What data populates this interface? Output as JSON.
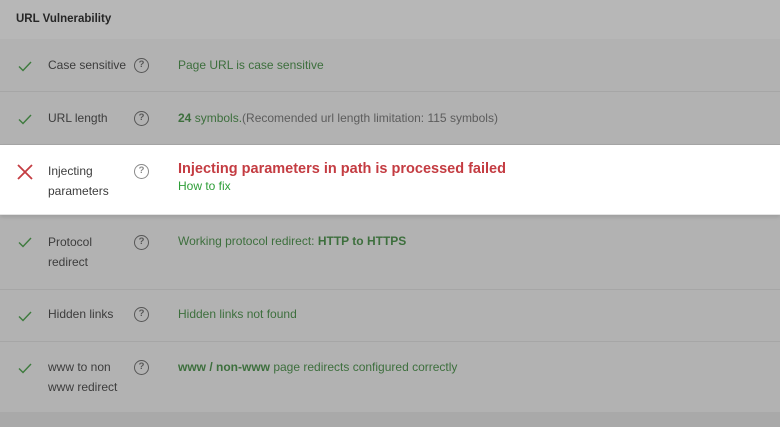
{
  "section_title": "URL Vulnerability",
  "help_glyph": "?",
  "colors": {
    "pass": "#3d6f3d",
    "fail": "#c43c42",
    "link": "#2e9e38"
  },
  "rows": [
    {
      "status": "check-icon",
      "label": "Case sensitive",
      "desc": "Page URL is case sensitive"
    },
    {
      "status": "check-icon",
      "label": "URL length",
      "desc_bold": "24",
      "desc_text": " symbols.",
      "desc_muted": "(Recomended url length limitation: 115 symbols)"
    },
    {
      "status": "cross-icon",
      "label": "Injecting parameters",
      "fail_title": "Injecting parameters in path is processed failed",
      "link": "How to fix"
    },
    {
      "status": "check-icon",
      "label": "Protocol redirect",
      "desc_text": "Working protocol redirect: ",
      "desc_bold": "HTTP to HTTPS"
    },
    {
      "status": "check-icon",
      "label": "Hidden links",
      "desc": "Hidden links not found"
    },
    {
      "status": "check-icon",
      "label": "www to non www redirect",
      "desc_bold": "www / non-www",
      "desc_text": " page redirects configured correctly"
    }
  ]
}
